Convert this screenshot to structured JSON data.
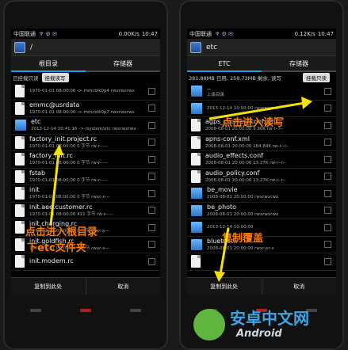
{
  "left": {
    "status": {
      "carrier": "中国联通",
      "speed": "0.00K/s",
      "time": "10:47"
    },
    "path": "/",
    "tabs": [
      "根目录",
      "存储器"
    ],
    "mount": {
      "label": "已挂载只读",
      "button": "挂载读写"
    },
    "rows": [
      {
        "name": "",
        "sub": "1970-01-01 08:00:00 -> mmcblk0p4 rwxrwxrwx",
        "kind": "file"
      },
      {
        "name": "emmc@usrdata",
        "sub": "1970-01-01 08:00:00 -> mmcblk0p7 rwxrwxrwx",
        "kind": "file"
      },
      {
        "name": "etc",
        "sub": "2013-12-14 10:41:16 -> /system/etc rwxrwxrwx",
        "kind": "folder"
      },
      {
        "name": "factory_init.project.rc",
        "sub": "1970-01-01 08:00:00 0 字节 rw-r-----",
        "kind": "file"
      },
      {
        "name": "factory_init.rc",
        "sub": "1970-01-01 08:00:00 0 字节 rw-r-----",
        "kind": "file"
      },
      {
        "name": "fstab",
        "sub": "1970-01-01 08:00:00 0 字节 rw-r-----",
        "kind": "file"
      },
      {
        "name": "init",
        "sub": "1970-01-01 08:00:00 0 字节 rwxr-x---",
        "kind": "file"
      },
      {
        "name": "init.aee.customer.rc",
        "sub": "1970-01-01 08:00:00 411 字节 rw-r-----",
        "kind": "file"
      },
      {
        "name": "init.charging.rc",
        "sub": "1970-01-01 08:00:00 0 字节 rwxr-x---",
        "kind": "file"
      },
      {
        "name": "init.goldfish.rc",
        "sub": "1970-01-01 08:00:00 0 字节 rwxr-x---",
        "kind": "file"
      },
      {
        "name": "init.modem.rc",
        "sub": "",
        "kind": "file"
      }
    ],
    "bottom": [
      "复制到此处",
      "取消"
    ],
    "annot": [
      "点击进入根目录",
      "下etc文件夹"
    ]
  },
  "right": {
    "status": {
      "carrier": "中国联通",
      "speed": "0.12K/s",
      "time": "10:47"
    },
    "path": "etc",
    "tabs": [
      "ETC",
      "存储器"
    ],
    "mount": {
      "label": "381.88MB 已用, 258.73MB 剩余, 读写",
      "button": "挂载只读"
    },
    "rows": [
      {
        "name": "..",
        "sub": "上级目录",
        "kind": "folder"
      },
      {
        "name": "",
        "sub": "2013-12-14 10:00:00 rwxrwxrwx",
        "kind": "folder"
      },
      {
        "name": "agps_profiles_conf.xml",
        "sub": "2008-08-01 20:00:00 9.90K rw-r--r--",
        "kind": "file"
      },
      {
        "name": "apns-conf.xml",
        "sub": "2008-08-01 20:00:00 184.84K rw-r--r--",
        "kind": "file"
      },
      {
        "name": "audio_effects.conf",
        "sub": "2008-08-01 20:00:00 13.27K rw-r--r--",
        "kind": "file"
      },
      {
        "name": "audio_policy.conf",
        "sub": "2008-08-01 20:00:00 13.27K rw-r--r--",
        "kind": "file"
      },
      {
        "name": "be_movie",
        "sub": "2008-08-01 20:00:00 rwxrwxrwx",
        "kind": "folder"
      },
      {
        "name": "be_photo",
        "sub": "2008-08-01 20:00:00 rwxrwxrwx",
        "kind": "folder"
      },
      {
        "name": "",
        "sub": "2013-12-14 10:00:00",
        "kind": "folder"
      },
      {
        "name": "bluetooth",
        "sub": "2008-08-01 20:00:00 rwxr-xr-x",
        "kind": "folder"
      },
      {
        "name": "",
        "sub": "",
        "kind": "file"
      }
    ],
    "bottom": [
      "复制到此处",
      "取消"
    ],
    "annot": [
      "点击进入读写",
      "复制覆盖"
    ]
  },
  "watermark": {
    "main": "安卓中文网",
    "sub": "Android"
  }
}
